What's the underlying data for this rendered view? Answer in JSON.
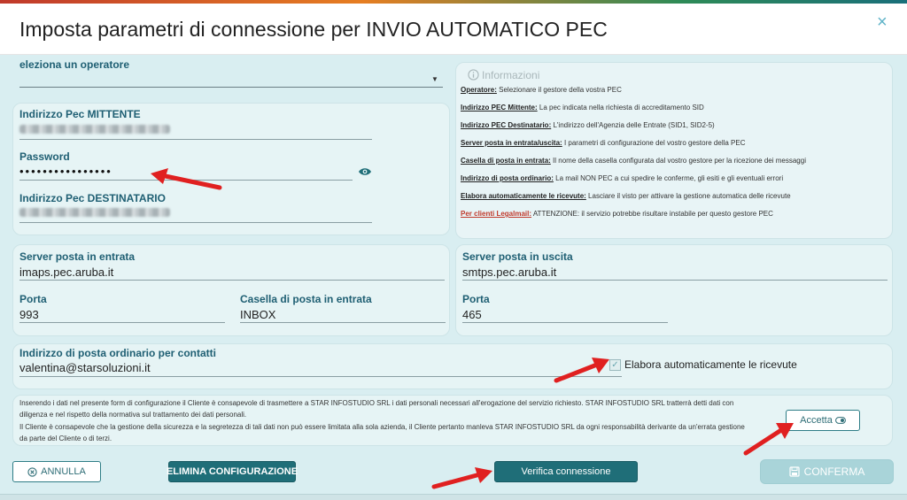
{
  "dialog": {
    "title": "Imposta parametri di connessione per INVIO AUTOMATICO PEC",
    "close_glyph": "×"
  },
  "operator": {
    "label": "eleziona un operatore",
    "selected": ""
  },
  "credentials": {
    "sender_label": "Indirizzo Pec MITTENTE",
    "password_label": "Password",
    "password_value": "••••••••••••••••",
    "recipient_label": "Indirizzo Pec DESTINATARIO"
  },
  "info": {
    "title": "Informazioni",
    "lines": [
      {
        "key": "Operatore:",
        "text": " Selezionare il gestore della vostra PEC"
      },
      {
        "key": "Indirizzo PEC Mittente:",
        "text": " La pec indicata nella richiesta di accreditamento SID"
      },
      {
        "key": "Indirizzo PEC Destinatario:",
        "text": " L'indirizzo dell'Agenzia delle Entrate (SID1, SID2-5)"
      },
      {
        "key": "Server posta in entrata/uscita:",
        "text": " I parametri di configurazione del vostro gestore della PEC"
      },
      {
        "key": "Casella di posta in entrata:",
        "text": " Il nome della casella configurata dal vostro gestore per la ricezione dei messaggi"
      },
      {
        "key": "Indirizzo di posta ordinario:",
        "text": " La mail NON PEC a cui spedire le conferme, gli esiti e gli eventuali errori"
      },
      {
        "key": "Elabora automaticamente le ricevute:",
        "text": " Lasciare il visto per attivare la gestione automatica delle ricevute"
      },
      {
        "key": "Per clienti Legalmail:",
        "text": " ATTENZIONE: il servizio potrebbe risultare instabile per questo gestore PEC"
      }
    ]
  },
  "incoming": {
    "server_label": "Server posta in entrata",
    "server_value": "imaps.pec.aruba.it",
    "port_label": "Porta",
    "port_value": "993",
    "mailbox_label": "Casella di posta in entrata",
    "mailbox_value": "INBOX"
  },
  "outgoing": {
    "server_label": "Server posta in uscita",
    "server_value": "smtps.pec.aruba.it",
    "port_label": "Porta",
    "port_value": "465"
  },
  "contact": {
    "label": "Indirizzo di posta ordinario per contatti",
    "value": "valentina@starsoluzioni.it",
    "auto_label": "Elabora automaticamente le ricevute",
    "auto_checked": true
  },
  "disclaimer": {
    "lines": [
      "Inserendo i dati nel presente form di configurazione il Cliente è consapevole di trasmettere a STAR INFOSTUDIO SRL i dati personali necessari all'erogazione del servizio richiesto. STAR INFOSTUDIO SRL tratterrà detti dati con",
      "diligenza e nel rispetto della normativa sul trattamento dei dati personali.",
      "Il Cliente è consapevole che la gestione della sicurezza e la segretezza di tali dati non può essere limitata alla sola azienda, il Cliente pertanto manleva STAR INFOSTUDIO SRL da ogni responsabilità derivante da un'errata gestione",
      "da parte del Cliente o di terzi."
    ],
    "accept_label": "Accetta"
  },
  "footer": {
    "cancel_label": "ANNULLA",
    "delete_label": "ELIMINA CONFIGURAZIONE",
    "verify_label": "Verifica connessione",
    "confirm_label": "CONFERMA"
  },
  "colors": {
    "accent": "#1f6e78",
    "label": "#1f5f73",
    "annotation_arrow": "#e02020"
  },
  "icons": {
    "close": "close-icon",
    "info": "info-icon",
    "eye": "eye-icon",
    "cancel": "cancel-circle-icon",
    "confirm": "save-icon",
    "accept": "toggle-icon",
    "dropdown": "chevron-down-icon"
  }
}
